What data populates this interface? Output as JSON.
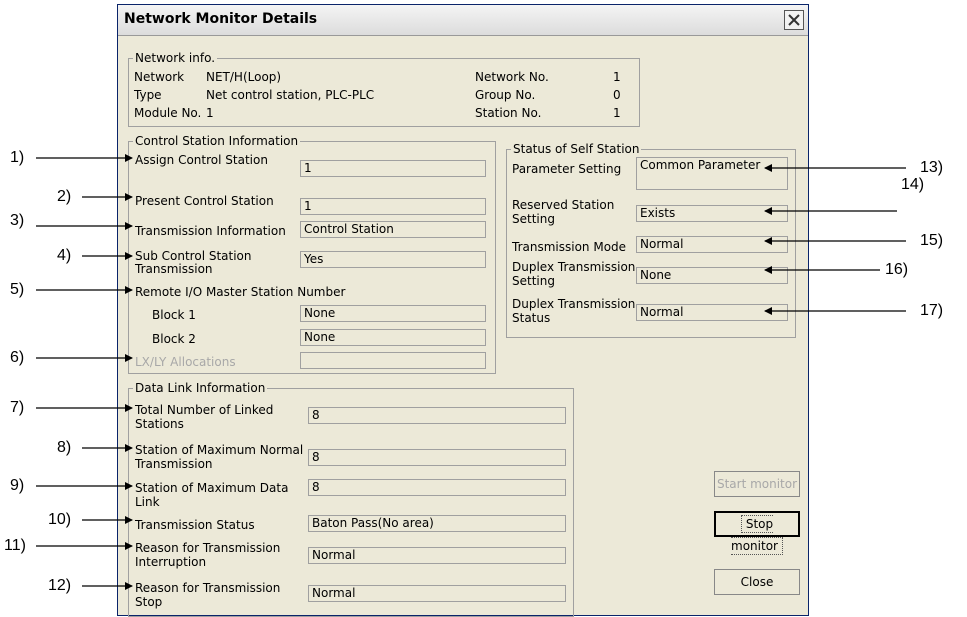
{
  "dialog": {
    "title": "Network Monitor Details"
  },
  "network_info": {
    "legend": "Network info.",
    "network_label": "Network",
    "network_value": "NET/H(Loop)",
    "type_label": "Type",
    "type_value": "Net control station, PLC-PLC",
    "module_label": "Module No.",
    "module_value": "1",
    "network_no_label": "Network No.",
    "network_no_value": "1",
    "group_no_label": "Group No.",
    "group_no_value": "0",
    "station_no_label": "Station No.",
    "station_no_value": "1"
  },
  "control_station": {
    "legend": "Control Station Information",
    "assign_label": "Assign Control Station",
    "assign_value": "1",
    "present_label": "Present Control Station",
    "present_value": "1",
    "transmission_label": "Transmission Information",
    "transmission_value": "Control Station",
    "sub_label_1": "Sub Control Station",
    "sub_label_2": "Transmission",
    "sub_value": "Yes",
    "remote_label": "Remote I/O Master Station Number",
    "block1_label": "Block 1",
    "block1_value": "None",
    "block2_label": "Block 2",
    "block2_value": "None",
    "lxly_label": "LX/LY Allocations",
    "lxly_value": ""
  },
  "self_station": {
    "legend": "Status of Self Station",
    "param_label": "Parameter Setting",
    "param_value": "Common Parameter",
    "reserved_label_1": "Reserved Station",
    "reserved_label_2": "Setting",
    "reserved_value": "Exists",
    "mode_label": "Transmission Mode",
    "mode_value": "Normal",
    "duplex_set_label_1": "Duplex Transmission",
    "duplex_set_label_2": "Setting",
    "duplex_set_value": "None",
    "duplex_stat_label_1": "Duplex Transmission",
    "duplex_stat_label_2": "Status",
    "duplex_stat_value": "Normal"
  },
  "data_link": {
    "legend": "Data Link Information",
    "total_label_1": "Total Number of Linked",
    "total_label_2": "Stations",
    "total_value": "8",
    "max_normal_label_1": "Station of Maximum Normal",
    "max_normal_label_2": "Transmission",
    "max_normal_value": "8",
    "max_link_label_1": "Station of Maximum Data",
    "max_link_label_2": "Link",
    "max_link_value": "8",
    "status_label": "Transmission Status",
    "status_value": "Baton Pass(No area)",
    "interrupt_label_1": "Reason for Transmission",
    "interrupt_label_2": "Interruption",
    "interrupt_value": "Normal",
    "stop_label_1": "Reason for Transmission",
    "stop_label_2": "Stop",
    "stop_value": "Normal"
  },
  "buttons": {
    "start": "Start monitor",
    "stop": "Stop monitor",
    "close": "Close"
  },
  "callouts": [
    "1)",
    "2)",
    "3)",
    "4)",
    "5)",
    "6)",
    "7)",
    "8)",
    "9)",
    "10)",
    "11)",
    "12)",
    "13)",
    "14)",
    "15)",
    "16)",
    "17)"
  ]
}
